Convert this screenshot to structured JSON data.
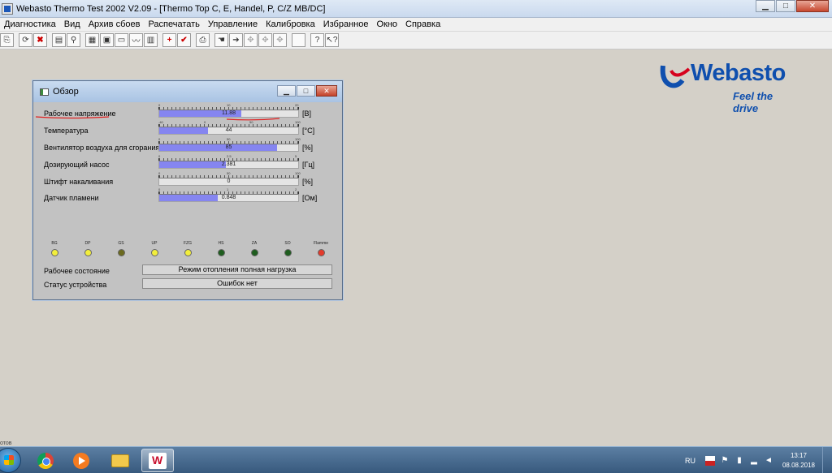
{
  "window": {
    "title": "Webasto Thermo Test 2002 V2.09 - [Thermo Top C, E, Handel, P, C/Z MB/DC]",
    "minimize": "▁",
    "maximize": "□",
    "close": "✕"
  },
  "menu": [
    "Диагностика",
    "Вид",
    "Архив сбоев",
    "Распечатать",
    "Управление",
    "Калибровка",
    "Избранное",
    "Окно",
    "Справка"
  ],
  "logo": {
    "brand": "Webasto",
    "tagline": "Feel the drive",
    "color": "#0f4fae"
  },
  "dialog": {
    "title": "Обзор",
    "params": [
      {
        "label": "Рабочее напряжение",
        "value": "11.88",
        "unit": "[В]",
        "fill": 0.59,
        "ticks": [
          "0",
          "10",
          "20"
        ]
      },
      {
        "label": "Температура",
        "value": "44",
        "unit": "[°C]",
        "fill": 0.35,
        "ticks": [
          "-40",
          "0",
          "50",
          "100"
        ]
      },
      {
        "label": "Вентилятор воздуха для сгорания",
        "value": "85",
        "unit": "[%]",
        "fill": 0.85,
        "ticks": [
          "0",
          "50",
          "100"
        ]
      },
      {
        "label": "Дозирующий насос",
        "value": "2.381",
        "unit": "[Гц]",
        "fill": 0.48,
        "ticks": [
          "0",
          "2.5",
          "5"
        ]
      },
      {
        "label": "Штифт накаливания",
        "value": "0",
        "unit": "[%]",
        "fill": 0.0,
        "ticks": [
          "0",
          "50",
          "100"
        ]
      },
      {
        "label": "Датчик пламени",
        "value": "0.848",
        "unit": "[Ом]",
        "fill": 0.42,
        "ticks": [
          "0",
          "1",
          "2"
        ]
      }
    ],
    "indicators": [
      {
        "label": "BG",
        "color": "#f2ee3c"
      },
      {
        "label": "DP",
        "color": "#f2ee3c"
      },
      {
        "label": "GS",
        "color": "#6b6a1e"
      },
      {
        "label": "UP",
        "color": "#f2ee3c"
      },
      {
        "label": "FZG",
        "color": "#f2ee3c"
      },
      {
        "label": "HS",
        "color": "#1e5d1e"
      },
      {
        "label": "ZA",
        "color": "#1e5d1e"
      },
      {
        "label": "SO",
        "color": "#1e5d1e"
      },
      {
        "label": "Flamme",
        "color": "#e33a2b"
      }
    ],
    "status": [
      {
        "label": "Рабочее состояние",
        "value": "Режим отопления полная нагрузка"
      },
      {
        "label": "Статус устройства",
        "value": "Ошибок нет"
      }
    ]
  },
  "statusbar": {
    "text": "отов"
  },
  "taskbar": {
    "lang": "RU",
    "time": "13:17",
    "date": "08.08.2018"
  }
}
